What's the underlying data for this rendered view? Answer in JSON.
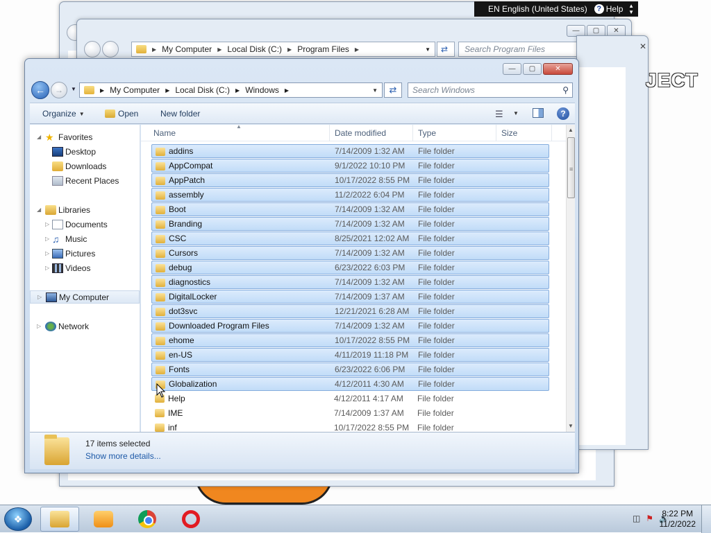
{
  "language_bar": {
    "lang": "EN English (United States)",
    "help": "Help"
  },
  "back_window": {
    "breadcrumb": [
      "My Computer",
      "Local Disk (C:)",
      "Program Files"
    ],
    "search_placeholder": "Search Program Files",
    "partial_text": "JECT"
  },
  "main_window": {
    "breadcrumb": [
      "My Computer",
      "Local Disk (C:)",
      "Windows"
    ],
    "search_placeholder": "Search Windows",
    "toolbar": {
      "organize": "Organize",
      "open": "Open",
      "new_folder": "New folder"
    },
    "nav": {
      "favorites": "Favorites",
      "desktop": "Desktop",
      "downloads": "Downloads",
      "recent_places": "Recent Places",
      "libraries": "Libraries",
      "documents": "Documents",
      "music": "Music",
      "pictures": "Pictures",
      "videos": "Videos",
      "my_computer": "My Computer",
      "network": "Network"
    },
    "columns": {
      "name": "Name",
      "date_modified": "Date modified",
      "type": "Type",
      "size": "Size"
    },
    "files": [
      {
        "name": "addins",
        "date": "7/14/2009 1:32 AM",
        "type": "File folder",
        "selected": true
      },
      {
        "name": "AppCompat",
        "date": "9/1/2022 10:10 PM",
        "type": "File folder",
        "selected": true
      },
      {
        "name": "AppPatch",
        "date": "10/17/2022 8:55 PM",
        "type": "File folder",
        "selected": true
      },
      {
        "name": "assembly",
        "date": "11/2/2022 6:04 PM",
        "type": "File folder",
        "selected": true
      },
      {
        "name": "Boot",
        "date": "7/14/2009 1:32 AM",
        "type": "File folder",
        "selected": true
      },
      {
        "name": "Branding",
        "date": "7/14/2009 1:32 AM",
        "type": "File folder",
        "selected": true
      },
      {
        "name": "CSC",
        "date": "8/25/2021 12:02 AM",
        "type": "File folder",
        "selected": true
      },
      {
        "name": "Cursors",
        "date": "7/14/2009 1:32 AM",
        "type": "File folder",
        "selected": true
      },
      {
        "name": "debug",
        "date": "6/23/2022 6:03 PM",
        "type": "File folder",
        "selected": true
      },
      {
        "name": "diagnostics",
        "date": "7/14/2009 1:32 AM",
        "type": "File folder",
        "selected": true
      },
      {
        "name": "DigitalLocker",
        "date": "7/14/2009 1:37 AM",
        "type": "File folder",
        "selected": true
      },
      {
        "name": "dot3svc",
        "date": "12/21/2021 6:28 AM",
        "type": "File folder",
        "selected": true
      },
      {
        "name": "Downloaded Program Files",
        "date": "7/14/2009 1:32 AM",
        "type": "File folder",
        "selected": true
      },
      {
        "name": "ehome",
        "date": "10/17/2022 8:55 PM",
        "type": "File folder",
        "selected": true
      },
      {
        "name": "en-US",
        "date": "4/11/2019 11:18 PM",
        "type": "File folder",
        "selected": true
      },
      {
        "name": "Fonts",
        "date": "6/23/2022 6:06 PM",
        "type": "File folder",
        "selected": true
      },
      {
        "name": "Globalization",
        "date": "4/12/2011 4:30 AM",
        "type": "File folder",
        "selected": true
      },
      {
        "name": "Help",
        "date": "4/12/2011 4:17 AM",
        "type": "File folder",
        "selected": false
      },
      {
        "name": "IME",
        "date": "7/14/2009 1:37 AM",
        "type": "File folder",
        "selected": false
      },
      {
        "name": "inf",
        "date": "10/17/2022 8:55 PM",
        "type": "File folder",
        "selected": false
      }
    ],
    "details": {
      "count": "17 items selected",
      "more": "Show more details..."
    }
  },
  "taskbar": {
    "time": "8:22 PM",
    "date": "11/2/2022"
  },
  "colors": {
    "selection": "#c1dcf8",
    "accent": "#1e5aa8",
    "close": "#c7483a"
  }
}
